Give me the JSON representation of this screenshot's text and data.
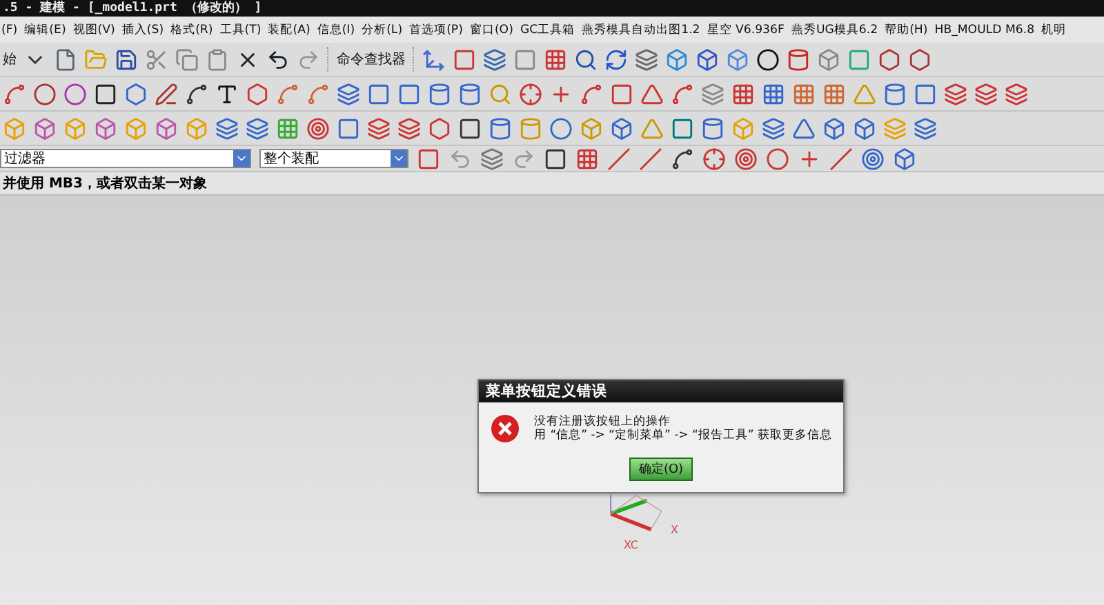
{
  "window": {
    "title": ".5 - 建模 - [_model1.prt （修改的） ]"
  },
  "menu": [
    "(F)",
    "编辑(E)",
    "视图(V)",
    "插入(S)",
    "格式(R)",
    "工具(T)",
    "装配(A)",
    "信息(I)",
    "分析(L)",
    "首选项(P)",
    "窗口(O)",
    "GC工具箱",
    "燕秀模具自动出图1.2",
    "星空 V6.936F",
    "燕秀UG模具6.2",
    "帮助(H)",
    "HB_MOULD M6.8",
    "机明"
  ],
  "toolbar": {
    "start_label": "始",
    "command_finder": "命令查找器"
  },
  "selection_bar": {
    "filter": "过滤器",
    "scope": "整个装配"
  },
  "status": "并使用 MB3，或者双击某一对象",
  "viewport": {
    "axis_labels": [
      "XC",
      "X"
    ]
  },
  "dialog": {
    "title": "菜单按钮定义错误",
    "lines": [
      "没有注册该按钮上的操作",
      "用 “信息” -> “定制菜单” -> “报告工具” 获取更多信息"
    ],
    "button": "确定(O)"
  }
}
